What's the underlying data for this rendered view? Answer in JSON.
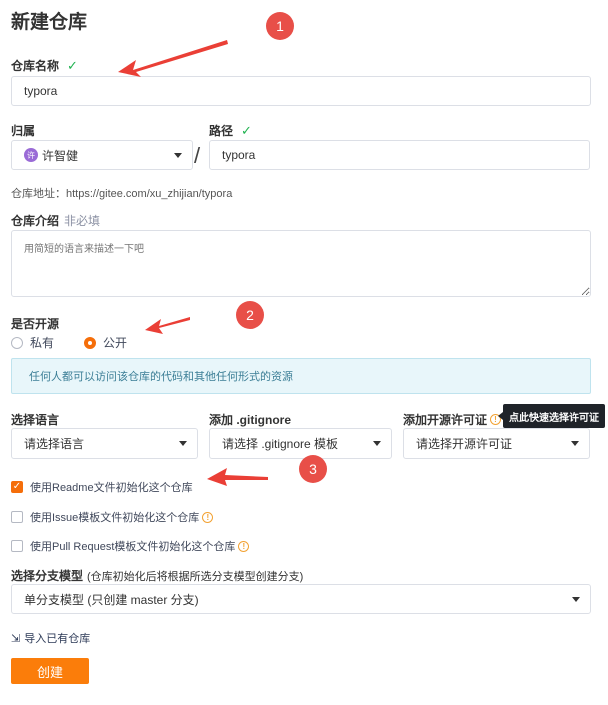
{
  "page_title": "新建仓库",
  "repo_name": {
    "label": "仓库名称",
    "value": "typora"
  },
  "owner": {
    "label": "归属",
    "avatar": "许",
    "name": "许智健"
  },
  "path": {
    "label": "路径",
    "value": "typora",
    "separator": "/"
  },
  "repo_url": "仓库地址：https://gitee.com/xu_zhijian/typora",
  "description": {
    "label": "仓库介绍",
    "optional": "非必填",
    "placeholder": "用简短的语言来描述一下吧"
  },
  "visibility": {
    "label": "是否开源",
    "options": [
      "私有",
      "公开"
    ],
    "selected": "公开",
    "notice": "任何人都可以访问该仓库的代码和其他任何形式的资源"
  },
  "language": {
    "label": "选择语言",
    "placeholder": "请选择语言"
  },
  "gitignore": {
    "label": "添加 .gitignore",
    "placeholder": "请选择 .gitignore 模板"
  },
  "license": {
    "label": "添加开源许可证",
    "placeholder": "请选择开源许可证",
    "tooltip": "点此快速选择许可证"
  },
  "init_options": [
    {
      "label": "使用Readme文件初始化这个仓库",
      "checked": true
    },
    {
      "label": "使用Issue模板文件初始化这个仓库",
      "checked": false
    },
    {
      "label": "使用Pull Request模板文件初始化这个仓库",
      "checked": false
    }
  ],
  "branch_model": {
    "label": "选择分支模型",
    "hint": "(仓库初始化后将根据所选分支模型创建分支)",
    "value": "单分支模型 (只创建 master 分支)"
  },
  "import_link": "导入已有仓库",
  "create_button": "创建",
  "annotations": [
    "1",
    "2",
    "3"
  ],
  "colors": {
    "accent": "#f56e0a",
    "check": "#21b351",
    "notice_bg": "#e8f6fa",
    "annotation": "#e84f48"
  }
}
